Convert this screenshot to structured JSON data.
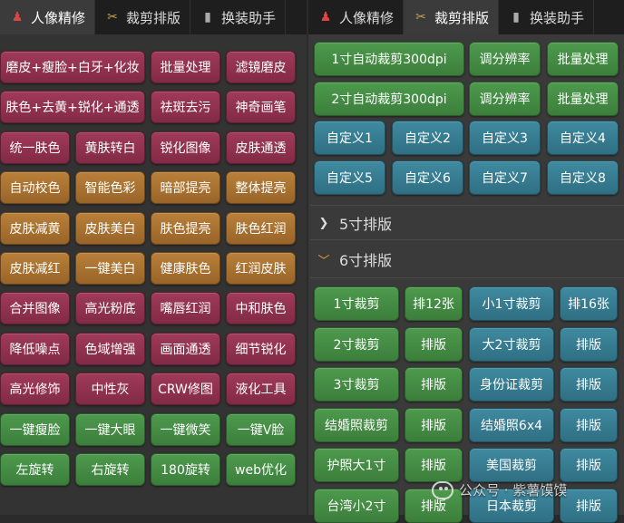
{
  "left_tabs": [
    {
      "label": "人像精修",
      "icon": "person-icon"
    },
    {
      "label": "裁剪排版",
      "icon": "scissors-icon"
    },
    {
      "label": "换装助手",
      "icon": "shirt-icon"
    }
  ],
  "right_tabs": [
    {
      "label": "人像精修",
      "icon": "person-icon"
    },
    {
      "label": "裁剪排版",
      "icon": "scissors-icon"
    },
    {
      "label": "换装助手",
      "icon": "shirt-icon"
    }
  ],
  "left_buttons": [
    [
      "磨皮+瘦脸+白牙+化妆",
      "批量处理",
      "滤镜磨皮"
    ],
    [
      "肤色+去黄+锐化+通透",
      "祛斑去污",
      "神奇画笔"
    ],
    [
      "统一肤色",
      "黄肤转白",
      "锐化图像",
      "皮肤通透"
    ],
    [
      "自动校色",
      "智能色彩",
      "暗部提亮",
      "整体提亮"
    ],
    [
      "皮肤减黄",
      "皮肤美白",
      "肤色提亮",
      "肤色红润"
    ],
    [
      "皮肤减红",
      "一键美白",
      "健康肤色",
      "红润皮肤"
    ],
    [
      "合并图像",
      "高光粉底",
      "嘴唇红润",
      "中和肤色"
    ],
    [
      "降低噪点",
      "色域增强",
      "画面通透",
      "细节锐化"
    ],
    [
      "高光修饰",
      "中性灰",
      "CRW修图",
      "液化工具"
    ],
    [
      "一键瘦脸",
      "一键大眼",
      "一键微笑",
      "一键V脸"
    ],
    [
      "左旋转",
      "右旋转",
      "180旋转",
      "web优化"
    ]
  ],
  "right_top_buttons": [
    [
      "1寸自动裁剪300dpi",
      "调分辨率",
      "批量处理"
    ],
    [
      "2寸自动裁剪300dpi",
      "调分辨率",
      "批量处理"
    ],
    [
      "自定义1",
      "自定义2",
      "自定义3",
      "自定义4"
    ],
    [
      "自定义5",
      "自定义6",
      "自定义7",
      "自定义8"
    ]
  ],
  "sections": {
    "five_inch": "5寸排版",
    "six_inch": "6寸排版"
  },
  "right_bottom_buttons": [
    [
      "1寸裁剪",
      "排12张",
      "小1寸裁剪",
      "排16张"
    ],
    [
      "2寸裁剪",
      "排版",
      "大2寸裁剪",
      "排版"
    ],
    [
      "3寸裁剪",
      "排版",
      "身份证裁剪",
      "排版"
    ],
    [
      "结婚照裁剪",
      "排版",
      "结婚照6x4",
      "排版"
    ],
    [
      "护照大1寸",
      "排版",
      "美国裁剪",
      "排版"
    ],
    [
      "台湾小2寸",
      "排版",
      "日本裁剪",
      "排版"
    ]
  ],
  "watermark": "公众号 · 紫薯馍馍",
  "colors": {
    "wine": "#8f3050",
    "gold": "#a8702f",
    "green": "#448c44",
    "teal": "#367c90",
    "chevron_open": "#e0a030"
  }
}
